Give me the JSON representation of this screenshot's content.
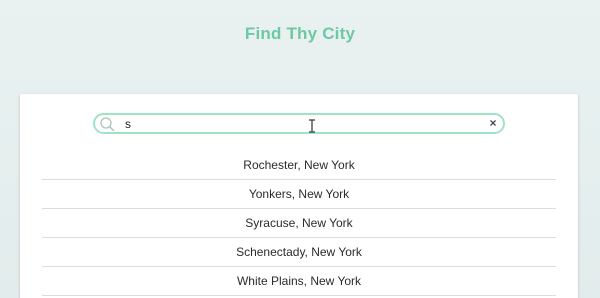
{
  "app": {
    "title": "Find Thy City"
  },
  "search": {
    "value": "s",
    "placeholder": "",
    "clear_icon": "×"
  },
  "results": [
    {
      "label": "Rochester, New York"
    },
    {
      "label": "Yonkers, New York"
    },
    {
      "label": "Syracuse, New York"
    },
    {
      "label": "Schenectady, New York"
    },
    {
      "label": "White Plains, New York"
    }
  ],
  "colors": {
    "accent": "#6cc9a4",
    "search_border": "#9fe3c5",
    "background": "#e6eeee"
  }
}
